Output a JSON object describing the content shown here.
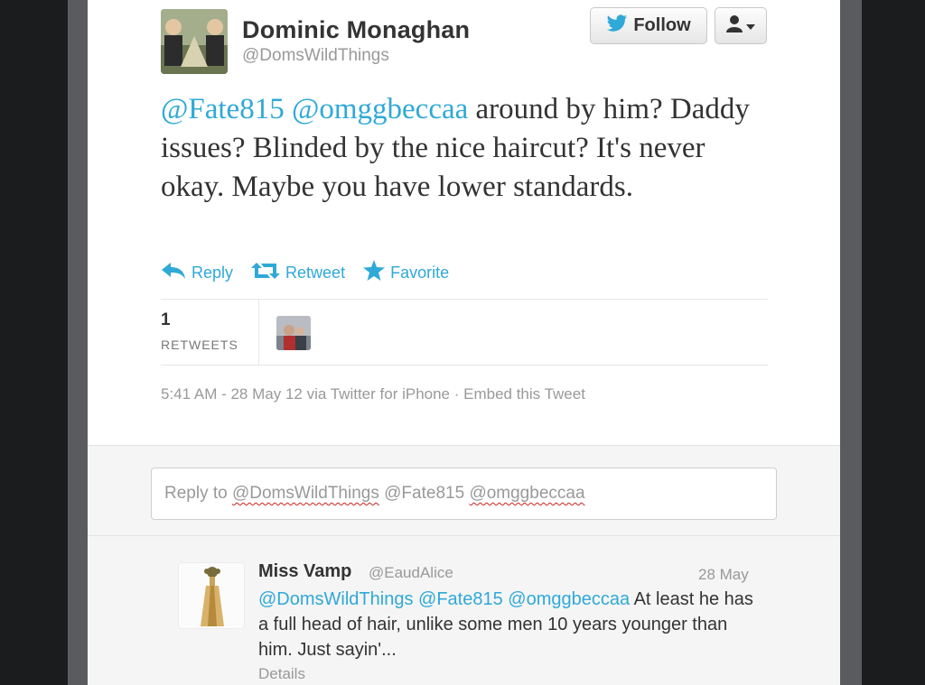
{
  "tweet": {
    "author_name": "Dominic Monaghan",
    "author_handle": "@DomsWildThings",
    "follow_label": "Follow",
    "mention_1": "@Fate815",
    "mention_2": "@omggbeccaa",
    "text_rest": " around by him? Daddy issues? Blinded by the nice haircut? It's never okay. Maybe you have lower standards.",
    "actions": {
      "reply": "Reply",
      "retweet": "Retweet",
      "favorite": "Favorite"
    },
    "retweet_count": "1",
    "retweet_label": "RETWEETS",
    "timestamp": "5:41 AM - 28 May 12 via Twitter for iPhone",
    "separator": " · ",
    "embed_label": "Embed this Tweet"
  },
  "reply_box": {
    "prefix": "Reply to ",
    "mention_1": "@DomsWildThings",
    "mention_2": "@Fate815",
    "mention_3": "@omggbeccaa"
  },
  "reply": {
    "name": "Miss Vamp",
    "handle": "@EaudAlice",
    "date": "28 May",
    "mention_1": "@DomsWildThings",
    "mention_2": "@Fate815",
    "mention_3": "@omggbeccaa",
    "text_rest": " At least he has a full head of hair, unlike some men 10 years younger than him. Just sayin'...",
    "details_label": "Details"
  },
  "colors": {
    "accent": "#2fa9d7",
    "text": "#333333",
    "muted": "#999999"
  },
  "icons": [
    "twitter-bird-icon",
    "user-icon",
    "caret-down-icon",
    "reply-icon",
    "retweet-icon",
    "star-icon"
  ]
}
